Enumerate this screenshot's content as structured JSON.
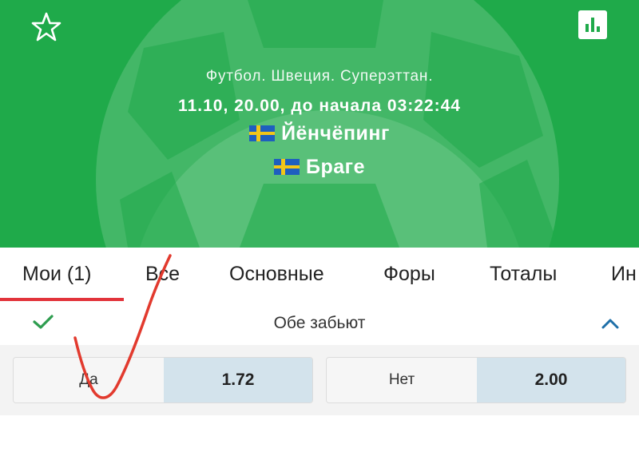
{
  "header": {
    "league": "Футбол. Швеция. Суперэттан.",
    "datetime": "11.10, 20.00,  до начала 03:22:44",
    "team1": "Йёнчёпинг",
    "team2": "Браге",
    "favorite_icon": "star-outline-icon",
    "stats_icon": "bar-chart-icon",
    "background_color": "#1faa4a"
  },
  "tabs": [
    {
      "label": "Мои (1)",
      "active": true
    },
    {
      "label": "Все"
    },
    {
      "label": "Основные"
    },
    {
      "label": "Форы"
    },
    {
      "label": "Тоталы"
    },
    {
      "label": "Ин"
    }
  ],
  "market": {
    "title": "Обе забьют",
    "selected_icon": "check-icon",
    "collapse_icon": "chevron-up-icon",
    "outcomes": [
      {
        "label": "Да",
        "odds": "1.72"
      },
      {
        "label": "Нет",
        "odds": "2.00"
      }
    ]
  },
  "colors": {
    "accent": "#e2333b",
    "odds_bg": "#d3e3ec",
    "check": "#2e9d4f"
  }
}
